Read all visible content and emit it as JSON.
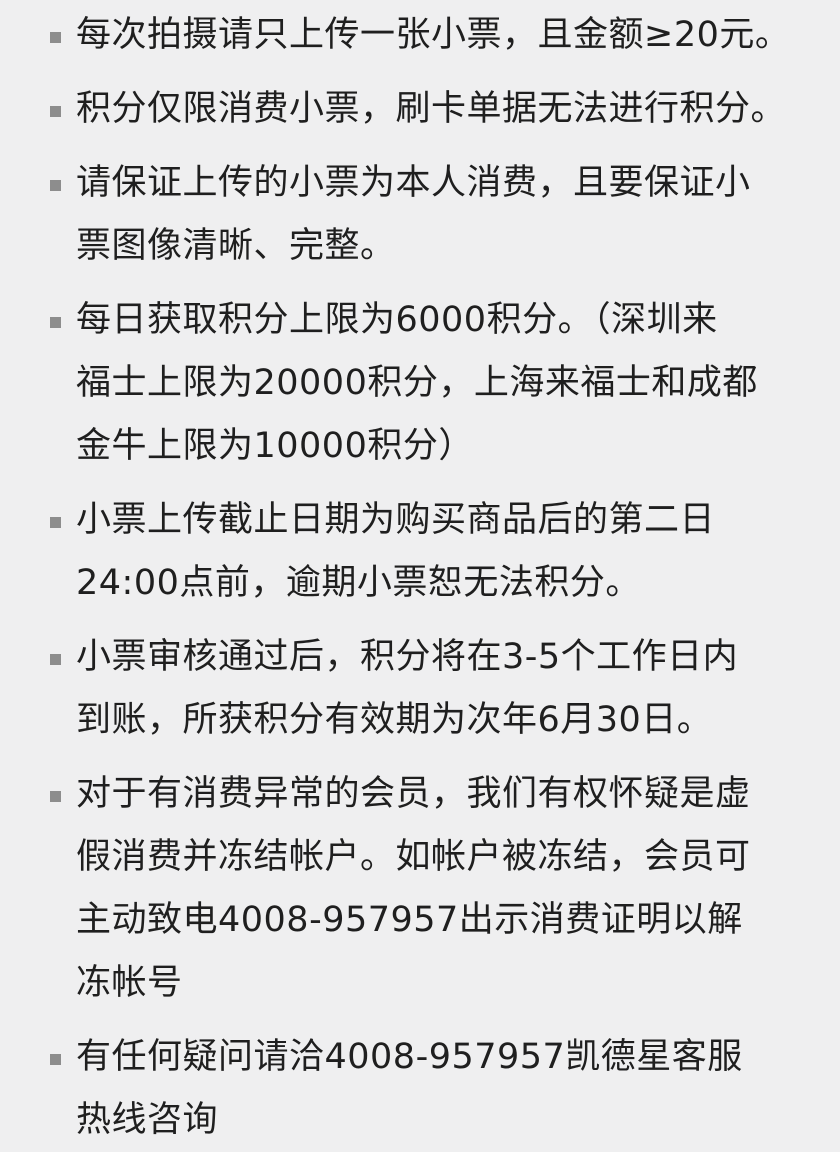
{
  "rules": [
    {
      "lines": [
        "每次拍摄请只上传一张小票，且金额≥20元。"
      ]
    },
    {
      "lines": [
        "积分仅限消费小票，刷卡单据无法进行积分。"
      ]
    },
    {
      "lines": [
        "请保证上传的小票为本人消费，且要保证小",
        "票图像清晰、完整。"
      ]
    },
    {
      "lines": [
        "每日获取积分上限为6000积分。（深圳来",
        "福士上限为20000积分，上海来福士和成都",
        "金牛上限为10000积分）"
      ]
    },
    {
      "lines": [
        "小票上传截止日期为购买商品后的第二日",
        "24:00点前，逾期小票恕无法积分。"
      ]
    },
    {
      "lines": [
        "小票审核通过后，积分将在3-5个工作日内",
        "到账，所获积分有效期为次年6月30日。"
      ]
    },
    {
      "lines": [
        "对于有消费异常的会员，我们有权怀疑是虚",
        "假消费并冻结帐户。如帐户被冻结，会员可",
        "主动致电4008-957957出示消费证明以解",
        "冻帐号"
      ]
    },
    {
      "lines": [
        "有任何疑问请洽4008-957957凯德星客服",
        "热线咨询"
      ]
    }
  ]
}
